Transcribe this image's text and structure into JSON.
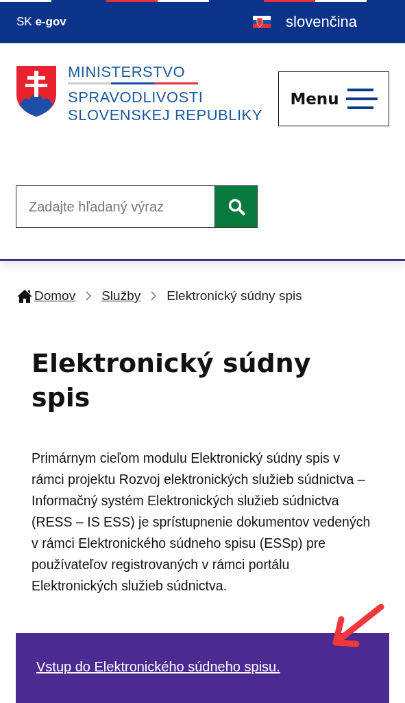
{
  "top_bar": {
    "brand_prefix": "SK",
    "brand": "e-gov",
    "language": "slovenčina"
  },
  "header": {
    "logo_lines": [
      "MINISTERSTVO",
      "SPRAVODLIVOSTI",
      "SLOVENSKEJ REPUBLIKY"
    ],
    "menu_button": "Menu"
  },
  "search": {
    "placeholder": "Zadajte hľadaný výraz"
  },
  "breadcrumb": [
    {
      "label": "Domov",
      "kind": "home"
    },
    {
      "label": "Služby",
      "kind": "link"
    },
    {
      "label": "Elektronický súdny spis",
      "kind": "current"
    }
  ],
  "title": "Elektronický súdny spis",
  "intro": "Primárnym cieľom modulu Elektronický súdny spis v rámci projektu Rozvoj elektronických služieb súdnictva – Informačný systém Elektronických služieb súdnictva (RESS – IS ESS) je sprístupnenie dokumentov vedených v rámci Elektronického súdneho spisu (ESSp) pre používateľov registrovaných v rámci portálu Elektronických služieb súdnictva.",
  "callout": {
    "link": "Vstup do Elektronického súdneho spisu."
  }
}
